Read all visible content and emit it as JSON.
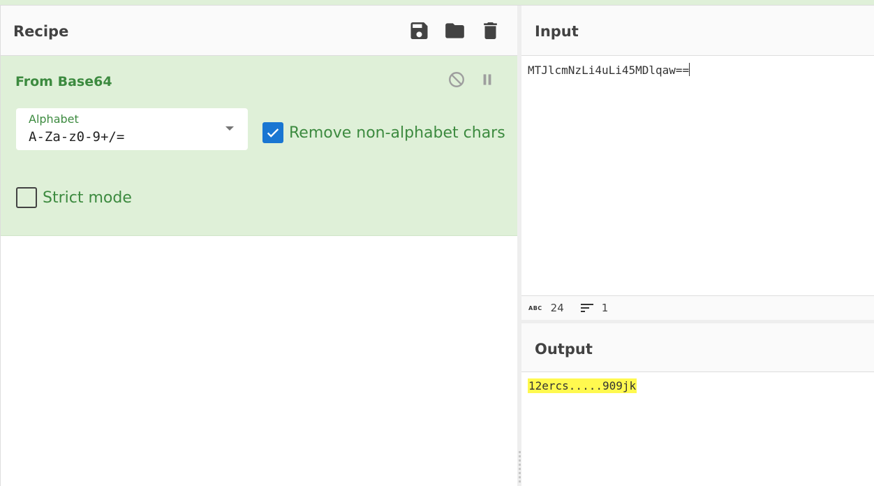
{
  "recipe": {
    "title": "Recipe",
    "header_icons": [
      "save-icon",
      "folder-icon",
      "trash-icon"
    ],
    "operation": {
      "name": "From Base64",
      "controls": [
        "disable-icon",
        "pause-icon"
      ],
      "alphabet": {
        "label": "Alphabet",
        "value": "A-Za-z0-9+/="
      },
      "remove_non_alphabet": {
        "label": "Remove non-alphabet chars",
        "checked": true
      },
      "strict_mode": {
        "label": "Strict mode",
        "checked": false
      }
    }
  },
  "input": {
    "title": "Input",
    "text": "MTJlcmNzLi4uLi45MDlqaw==",
    "status": {
      "char_count": "24",
      "line_count": "1"
    }
  },
  "output": {
    "title": "Output",
    "text": "12ercs.....909jk"
  },
  "colors": {
    "operation_bg": "#dff0d8",
    "operation_text": "#3c8a3f",
    "checkbox_checked": "#1976d2",
    "output_highlight": "#fff94f"
  }
}
